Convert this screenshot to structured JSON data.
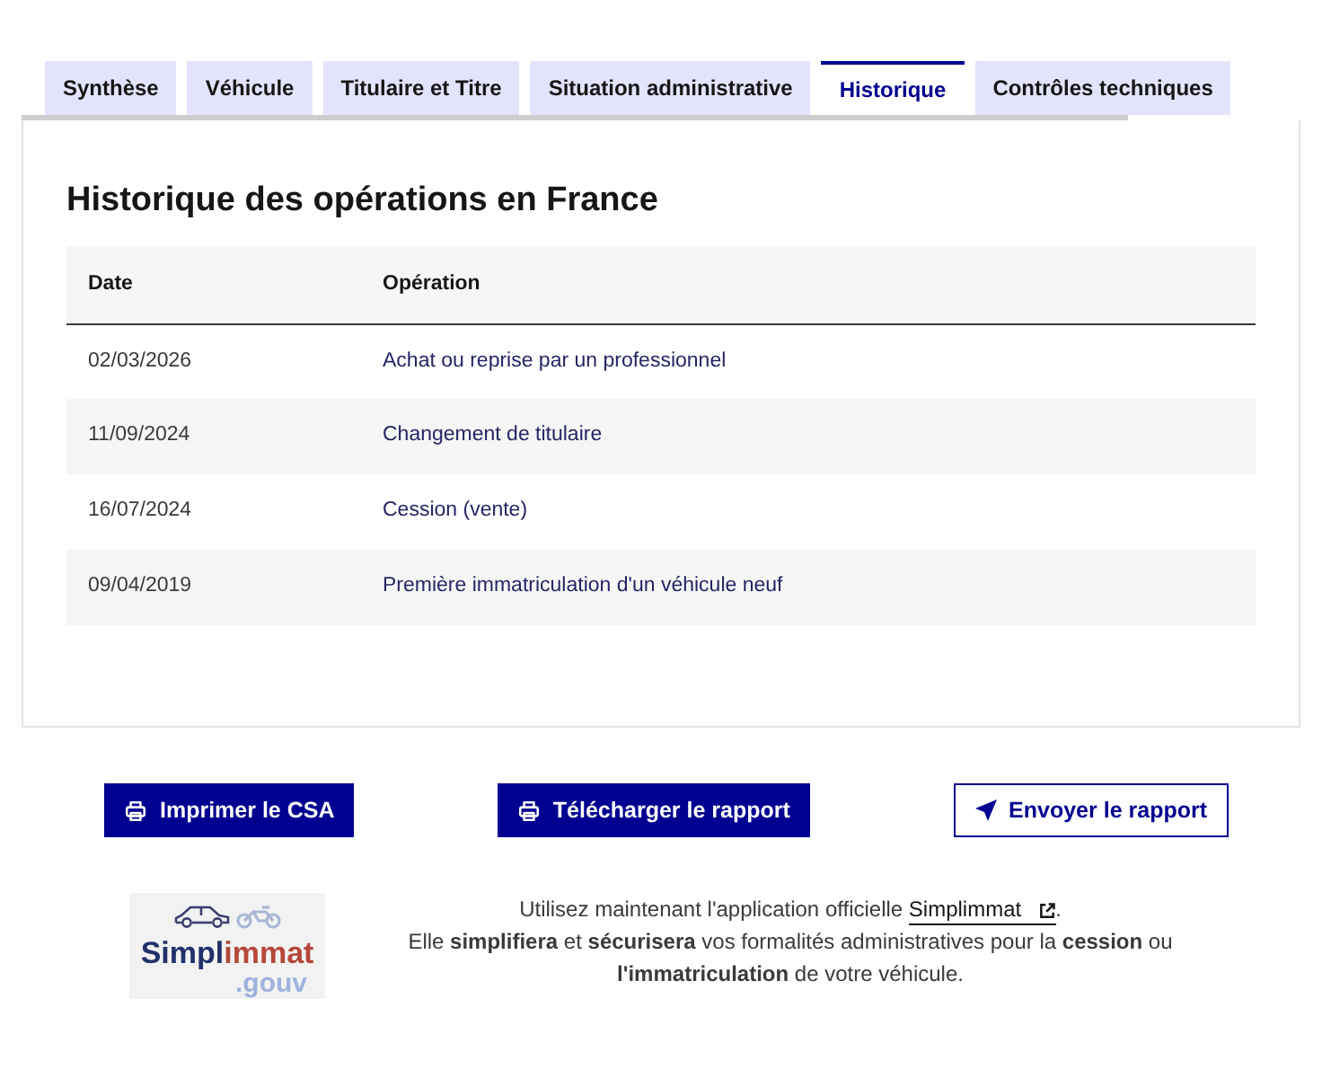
{
  "tabs": [
    {
      "label": "Synthèse",
      "selected": false
    },
    {
      "label": "Véhicule",
      "selected": false
    },
    {
      "label": "Titulaire et Titre",
      "selected": false
    },
    {
      "label": "Situation administrative",
      "selected": false
    },
    {
      "label": "Historique",
      "selected": true
    },
    {
      "label": "Contrôles techniques",
      "selected": false
    }
  ],
  "panel": {
    "title": "Historique des opérations en France",
    "table": {
      "columns": [
        "Date",
        "Opération"
      ],
      "rows": [
        [
          "02/03/2026",
          "Achat ou reprise par un professionnel"
        ],
        [
          "11/09/2024",
          "Changement de titulaire"
        ],
        [
          "16/07/2024",
          "Cession (vente)"
        ],
        [
          "09/04/2019",
          "Première immatriculation d'un véhicule neuf"
        ]
      ]
    }
  },
  "actions": [
    {
      "label": "Imprimer le CSA",
      "kind": "primary"
    },
    {
      "label": "Télécharger le rapport",
      "kind": "primary"
    },
    {
      "label": "Envoyer le rapport",
      "kind": "secondary"
    }
  ],
  "promo": {
    "logo": {
      "wordmark": "Simpl",
      "wordmark_accent": "immat",
      "domain": ".gouv"
    },
    "text_before_link": "Utilisez maintenant l'application officielle ",
    "link": "Simplimmat",
    "text_after_link": ".",
    "text_second": "Elle **simplifiera** et **sécurisera** vos formalités administratives pour la **cession** ou **l'immatriculation** de votre véhicule."
  }
}
